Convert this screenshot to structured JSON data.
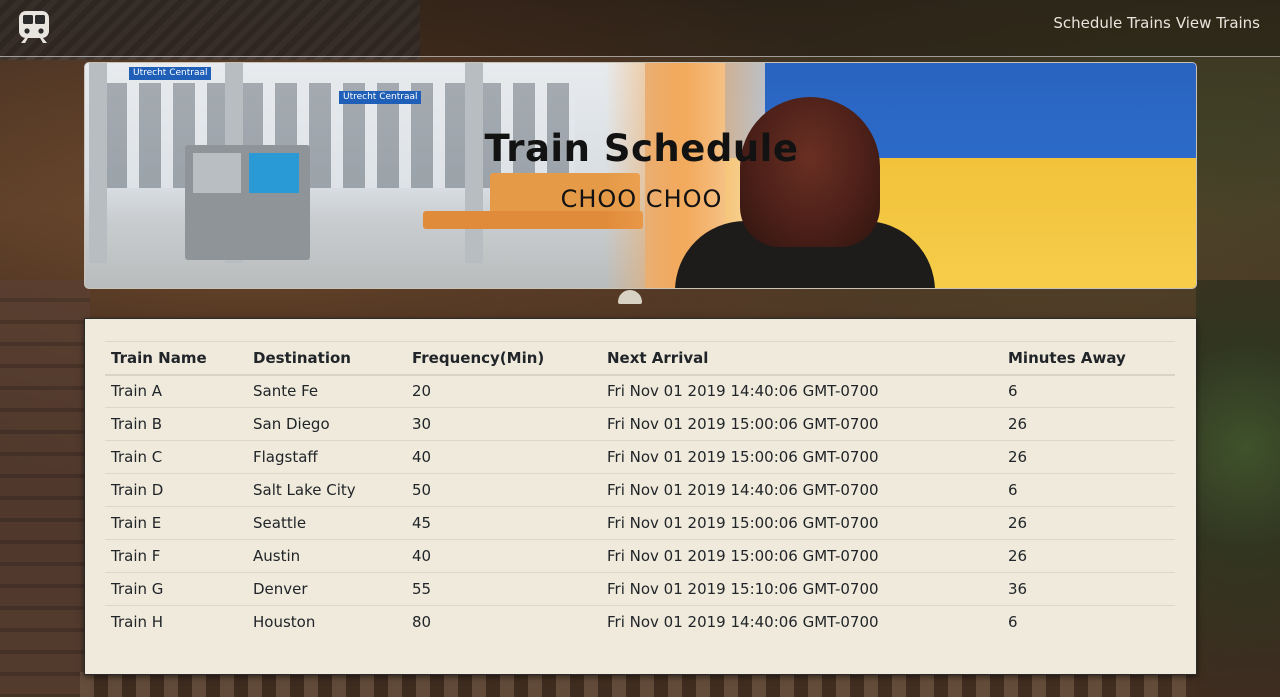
{
  "navbar": {
    "brand_icon": "train-icon",
    "links": [
      "Schedule Trains",
      "View Trains"
    ]
  },
  "hero": {
    "title": "Train Schedule",
    "subtitle": "CHOO CHOO",
    "signs": [
      "Utrecht Centraal",
      "Utrecht Centraal"
    ]
  },
  "table": {
    "headers": [
      "Train Name",
      "Destination",
      "Frequency(Min)",
      "Next Arrival",
      "Minutes Away"
    ],
    "rows": [
      [
        "Train A",
        "Sante Fe",
        "20",
        "Fri Nov 01 2019 14:40:06 GMT-0700",
        "6"
      ],
      [
        "Train B",
        "San Diego",
        "30",
        "Fri Nov 01 2019 15:00:06 GMT-0700",
        "26"
      ],
      [
        "Train C",
        "Flagstaff",
        "40",
        "Fri Nov 01 2019 15:00:06 GMT-0700",
        "26"
      ],
      [
        "Train D",
        "Salt Lake City",
        "50",
        "Fri Nov 01 2019 14:40:06 GMT-0700",
        "6"
      ],
      [
        "Train E",
        "Seattle",
        "45",
        "Fri Nov 01 2019 15:00:06 GMT-0700",
        "26"
      ],
      [
        "Train F",
        "Austin",
        "40",
        "Fri Nov 01 2019 15:00:06 GMT-0700",
        "26"
      ],
      [
        "Train G",
        "Denver",
        "55",
        "Fri Nov 01 2019 15:10:06 GMT-0700",
        "36"
      ],
      [
        "Train H",
        "Houston",
        "80",
        "Fri Nov 01 2019 14:40:06 GMT-0700",
        "6"
      ]
    ]
  }
}
